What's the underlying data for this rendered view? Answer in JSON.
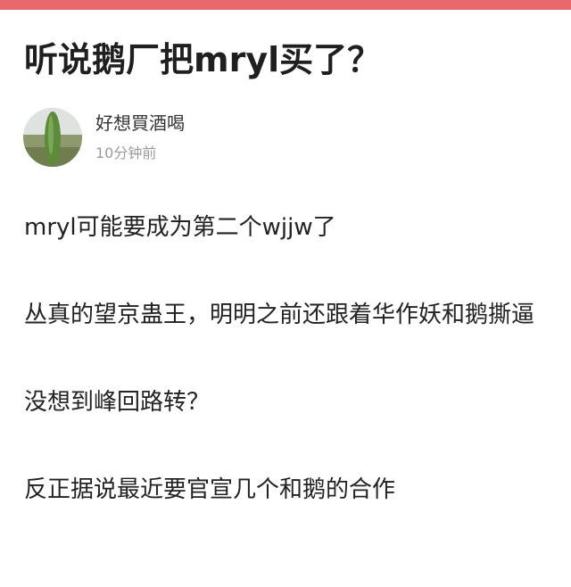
{
  "header": {
    "accent_color": "#e8686b"
  },
  "post": {
    "title": "听说鹅厂把mryl买了？",
    "author": {
      "name": "好想買酒喝",
      "avatar_icon": "avatar-photo"
    },
    "time": "10分钟前",
    "paragraphs": [
      "mryl可能要成为第二个wjjw了",
      "丛真的望京蛊王，明明之前还跟着华作妖和鹅撕逼",
      "没想到峰回路转？",
      "反正据说最近要官宣几个和鹅的合作"
    ]
  }
}
